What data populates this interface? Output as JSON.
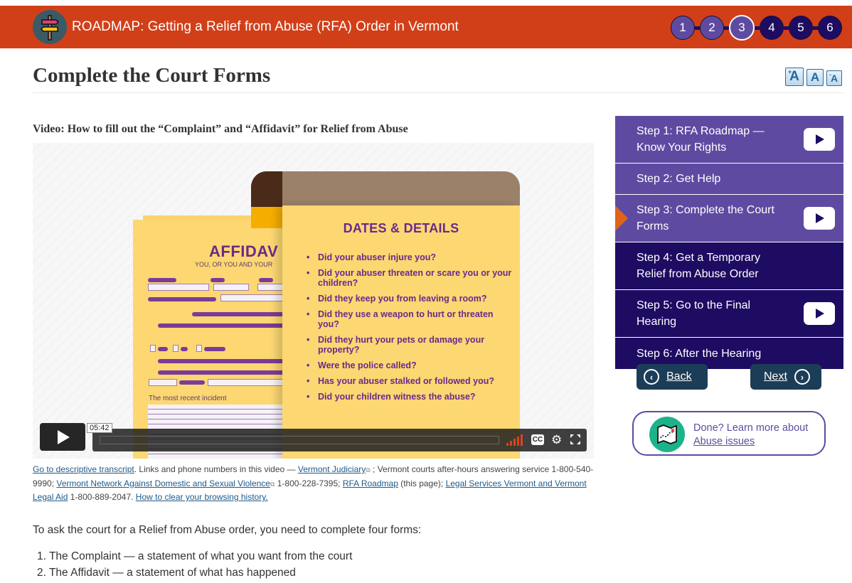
{
  "header": {
    "logo_icon": "signpost-icon",
    "title": "ROADMAP: Getting a Relief from Abuse (RFA) Order in Vermont",
    "steps": [
      {
        "number": "1",
        "state": "done"
      },
      {
        "number": "2",
        "state": "done"
      },
      {
        "number": "3",
        "state": "current"
      },
      {
        "number": "4",
        "state": "future"
      },
      {
        "number": "5",
        "state": "future"
      },
      {
        "number": "6",
        "state": "future"
      }
    ]
  },
  "page": {
    "title": "Complete the Court Forms",
    "font_size_controls": {
      "increase": "A",
      "increase_sup": "+",
      "reset": "A",
      "decrease": "A",
      "decrease_sup": "-"
    }
  },
  "video": {
    "heading": "Video: How to fill out the “Complaint” and “Affidavit” for Relief from Abuse",
    "frame": {
      "affidavit_title": "AFFIDAV",
      "affidavit_subtitle": "YOU, OR YOU AND YOUR",
      "recent_incident_label": "The most recent incident",
      "details_title": "DATES & DETAILS",
      "details_items": [
        "Did your abuser injure you?",
        "Did your abuser threaten or scare you or your children?",
        "Did they keep you from leaving a room?",
        "Did they use a weapon to hurt or threaten you?",
        "Did they hurt your pets or damage your property?",
        "Were the police called?",
        "Has your abuser stalked or followed you?",
        "Did your children witness the abuse?"
      ]
    },
    "player": {
      "duration": "05:42",
      "progress_fraction": 0,
      "cc_label": "CC",
      "icons": [
        "play-icon",
        "volume-icon",
        "cc-icon",
        "settings-icon",
        "fullscreen-icon"
      ]
    }
  },
  "caption": {
    "transcript_link": "Go to descriptive transcript",
    "text1": ". Links and phone numbers in this video — ",
    "link_judiciary": "Vermont Judiciary",
    "text2": " ; Vermont courts after-hours answering service 1-800-540-9990; ",
    "link_network": "Vermont Network Against Domestic and Sexual Violence",
    "text3": "  1-800-228-7395; ",
    "link_roadmap": "RFA Roadmap",
    "text4": " (this page); ",
    "link_legal": "Legal Services Vermont and Vermont Legal Aid",
    "text5": " 1-800-889-2047. ",
    "link_history": "How to clear your browsing history."
  },
  "body": {
    "intro": "To ask the court for a Relief from Abuse order, you need to complete four forms:",
    "forms": [
      "1. The Complaint — a statement of what you want from the court",
      "2. The Affidavit — a statement of what has happened"
    ]
  },
  "sidebar": {
    "items": [
      {
        "label": "Step 1: RFA Roadmap — Know Your Rights",
        "state": "done",
        "has_video": true
      },
      {
        "label": "Step 2: Get Help",
        "state": "done",
        "has_video": false
      },
      {
        "label": "Step 3: Complete the Court Forms",
        "state": "current",
        "has_video": true
      },
      {
        "label": "Step 4: Get a Temporary Relief from Abuse Order",
        "state": "future",
        "has_video": false
      },
      {
        "label": "Step 5: Go to the Final Hearing",
        "state": "future",
        "has_video": true
      },
      {
        "label": "Step 6: After the Hearing",
        "state": "future",
        "has_video": false
      }
    ],
    "back_label": "Back",
    "next_label": "Next",
    "learn_more_text": "Done? Learn more about",
    "learn_more_link": "Abuse issues"
  },
  "colors": {
    "header_bg": "#d13f19",
    "step_done": "#5e4ba1",
    "step_future": "#1e0b62",
    "current_marker": "#e0631a",
    "nav_button": "#1c3d57",
    "link": "#1f5a8a",
    "map_icon_bg": "#1db38a"
  }
}
